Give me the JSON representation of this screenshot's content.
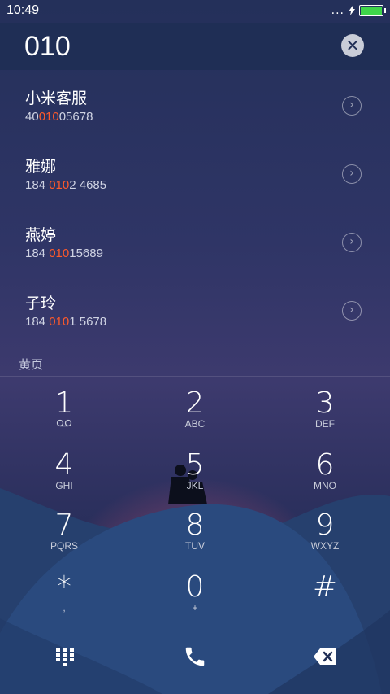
{
  "status_bar": {
    "time": "10:49",
    "signal_dots": "...",
    "charging_icon": "bolt-icon",
    "battery_color": "#3fd64a"
  },
  "dial_input": {
    "value": "010",
    "clear_icon": "close-icon"
  },
  "highlight_color": "#ff5a2a",
  "results": [
    {
      "name": "小米客服",
      "number_prefix": "40",
      "number_match": "010",
      "number_suffix": "05678"
    },
    {
      "name": "雅娜",
      "number_prefix": "184 ",
      "number_match": "010",
      "number_suffix": "2 4685"
    },
    {
      "name": "燕婷",
      "number_prefix": "184 ",
      "number_match": "010",
      "number_suffix": "15689"
    },
    {
      "name": "子玲",
      "number_prefix": "184 ",
      "number_match": "010",
      "number_suffix": "1 5678"
    }
  ],
  "section_label": "黄页",
  "keypad": [
    {
      "digit": "1",
      "letters": "",
      "sub_icon": "voicemail-icon"
    },
    {
      "digit": "2",
      "letters": "ABC"
    },
    {
      "digit": "3",
      "letters": "DEF"
    },
    {
      "digit": "4",
      "letters": "GHI"
    },
    {
      "digit": "5",
      "letters": "JKL"
    },
    {
      "digit": "6",
      "letters": "MNO"
    },
    {
      "digit": "7",
      "letters": "PQRS"
    },
    {
      "digit": "8",
      "letters": "TUV"
    },
    {
      "digit": "9",
      "letters": "WXYZ"
    },
    {
      "digit": "*",
      "letters": ","
    },
    {
      "digit": "0",
      "letters": "+"
    },
    {
      "digit": "#",
      "letters": ""
    }
  ],
  "bottom_bar": {
    "left_icon": "dialpad-icon",
    "center_icon": "phone-icon",
    "right_icon": "backspace-icon"
  }
}
